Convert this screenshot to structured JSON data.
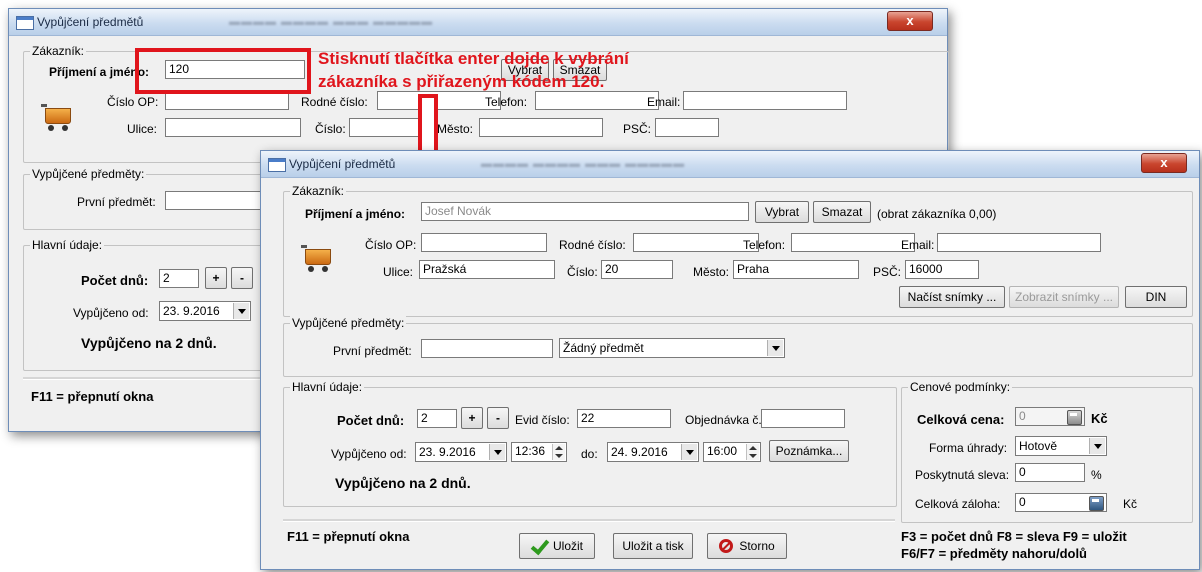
{
  "annotation": {
    "text_line1": "Stisknutí tlačítka enter dojde k vybrání",
    "text_line2": "zákazníka s přiřazeným kódem 120.",
    "color": "#e0151c"
  },
  "back_window": {
    "title": "Vypůjčení předmětů",
    "close_label": "x",
    "customer_group": "Zákazník:",
    "name_label": "Příjmení a jméno:",
    "name_value": "120",
    "select_btn": "Vybrat",
    "clear_btn": "Smazat",
    "id_label": "Číslo OP:",
    "birth_label": "Rodné číslo:",
    "phone_label": "Telefon:",
    "email_label": "Email:",
    "street_label": "Ulice:",
    "number_label": "Číslo:",
    "city_label": "Město:",
    "zip_label": "PSČ:",
    "items_group": "Vypůjčené předměty:",
    "first_item_label": "První předmět:",
    "main_group": "Hlavní údaje:",
    "days_label": "Počet dnů:",
    "days_value": "2",
    "plus": "+",
    "minus": "-",
    "from_label": "Vypůjčeno od:",
    "from_date": "23. 9.2016",
    "days_text": "Vypůjčeno na 2 dnů.",
    "f11": "F11 = přepnutí okna"
  },
  "front_window": {
    "title": "Vypůjčení předmětů",
    "close_label": "x",
    "customer_group": "Zákazník:",
    "name_label": "Příjmení a jméno:",
    "name_value": "Josef Novák",
    "select_btn": "Vybrat",
    "clear_btn": "Smazat",
    "turnover": "(obrat zákazníka 0,00)",
    "id_label": "Číslo OP:",
    "birth_label": "Rodné číslo:",
    "phone_label": "Telefon:",
    "email_label": "Email:",
    "street_label": "Ulice:",
    "street_value": "Pražská",
    "number_label": "Číslo:",
    "number_value": "20",
    "city_label": "Město:",
    "city_value": "Praha",
    "zip_label": "PSČ:",
    "zip_value": "16000",
    "load_photos": "Načíst snímky ...",
    "show_photos": "Zobrazit snímky ...",
    "din": "DIN",
    "items_group": "Vypůjčené předměty:",
    "first_item_label": "První předmět:",
    "item_select": "Žádný předmět",
    "main_group": "Hlavní údaje:",
    "days_label": "Počet dnů:",
    "days_value": "2",
    "plus": "+",
    "minus": "-",
    "evid_label": "Evid číslo:",
    "evid_value": "22",
    "order_label": "Objednávka č.",
    "from_label": "Vypůjčeno od:",
    "from_date": "23. 9.2016",
    "from_time": "12:36",
    "to_label": "do:",
    "to_date": "24. 9.2016",
    "to_time": "16:00",
    "note_btn": "Poznámka...",
    "days_text": "Vypůjčeno na 2 dnů.",
    "price_group": "Cenové podmínky:",
    "total_label": "Celková cena:",
    "total_value": "0",
    "currency": "Kč",
    "payment_label": "Forma úhrady:",
    "payment_value": "Hotově",
    "discount_label": "Poskytnutá sleva:",
    "discount_value": "0",
    "percent": "%",
    "deposit_label": "Celková záloha:",
    "deposit_value": "0",
    "f11": "F11 = přepnutí okna",
    "save_btn": "Uložit",
    "save_print_btn": "Uložit a tisk",
    "cancel_btn": "Storno",
    "shortcuts_line1": "F3 = počet dnů  F8 = sleva  F9 = uložit",
    "shortcuts_line2": "F6/F7 = předměty nahoru/dolů"
  }
}
